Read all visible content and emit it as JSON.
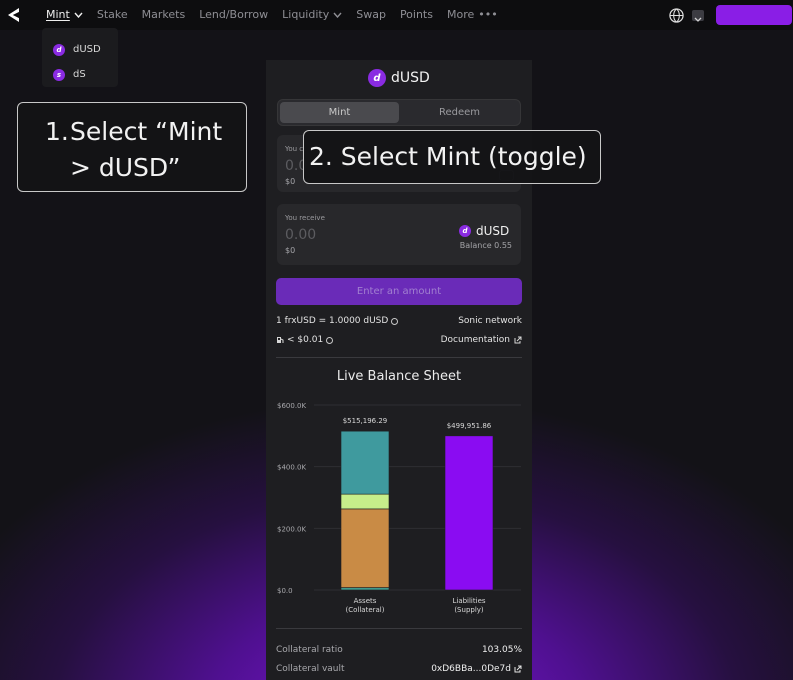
{
  "topbar": {
    "nav": [
      {
        "label": "Mint",
        "active": true,
        "has_chevron": true
      },
      {
        "label": "Stake"
      },
      {
        "label": "Markets"
      },
      {
        "label": "Lend/Borrow"
      },
      {
        "label": "Liquidity",
        "has_chevron": true
      },
      {
        "label": "Swap"
      },
      {
        "label": "Points"
      },
      {
        "label": "More",
        "has_dots": true
      }
    ],
    "more_dots": "•••",
    "icons": [
      "logo-icon",
      "globe-icon",
      "chevron-down-icon"
    ],
    "accent_color": "#8a1ee6"
  },
  "mint_dropdown": {
    "items": [
      {
        "label": "dUSD",
        "icon": "d"
      },
      {
        "label": "dS",
        "icon": "s"
      }
    ]
  },
  "callouts": {
    "first": {
      "number": "1.",
      "line1": "Select “Mint",
      "line2": "> dUSD”"
    },
    "second": {
      "text": "2. Select Mint (toggle)"
    }
  },
  "panel": {
    "token": "dUSD",
    "token_glyph": "d",
    "toggle": {
      "mint": "Mint",
      "redeem": "Redeem"
    },
    "pay": {
      "label": "You c",
      "placeholder": "0.0",
      "usd": "$0"
    },
    "receive": {
      "label": "You receive",
      "placeholder": "0.00",
      "usd": "$0",
      "token": "dUSD",
      "balance": "Balance 0.55"
    },
    "enter_button": "Enter an amount",
    "rate": "1 frxUSD =  1.0000 dUSD",
    "network": "Sonic network",
    "gas": "< $0.01",
    "documentation": "Documentation",
    "balance_sheet_title": "Live Balance Sheet",
    "collateral_ratio_label": "Collateral ratio",
    "collateral_ratio_value": "103.05%",
    "collateral_vault_label": "Collateral vault",
    "collateral_vault_value": "0xD6BBa...0De7d"
  },
  "chart_data": {
    "type": "bar",
    "title": "Live Balance Sheet",
    "categories": [
      "Assets\n(Collateral)",
      "Liabilities\n(Supply)"
    ],
    "category_lines": [
      [
        "Assets",
        "(Collateral)"
      ],
      [
        "Liabilities",
        "(Supply)"
      ]
    ],
    "y_ticks": [
      "$0.0",
      "$200.0K",
      "$400.0K",
      "$600.0K"
    ],
    "ylim": [
      0,
      600000
    ],
    "value_labels": [
      "$515,196.29",
      "$499,951.86"
    ],
    "stacks": [
      {
        "category": "Assets\n(Collateral)",
        "segments": [
          {
            "value": 8000,
            "color": "#3f9a8e"
          },
          {
            "value": 255000,
            "color": "#c98b45"
          },
          {
            "value": 48000,
            "color": "#c6ee8a"
          },
          {
            "value": 204196.29,
            "color": "#3f9a9e"
          }
        ]
      },
      {
        "category": "Liabilities\n(Supply)",
        "segments": [
          {
            "value": 499951.86,
            "color": "#8a0cf2"
          }
        ]
      }
    ],
    "grid": true
  }
}
